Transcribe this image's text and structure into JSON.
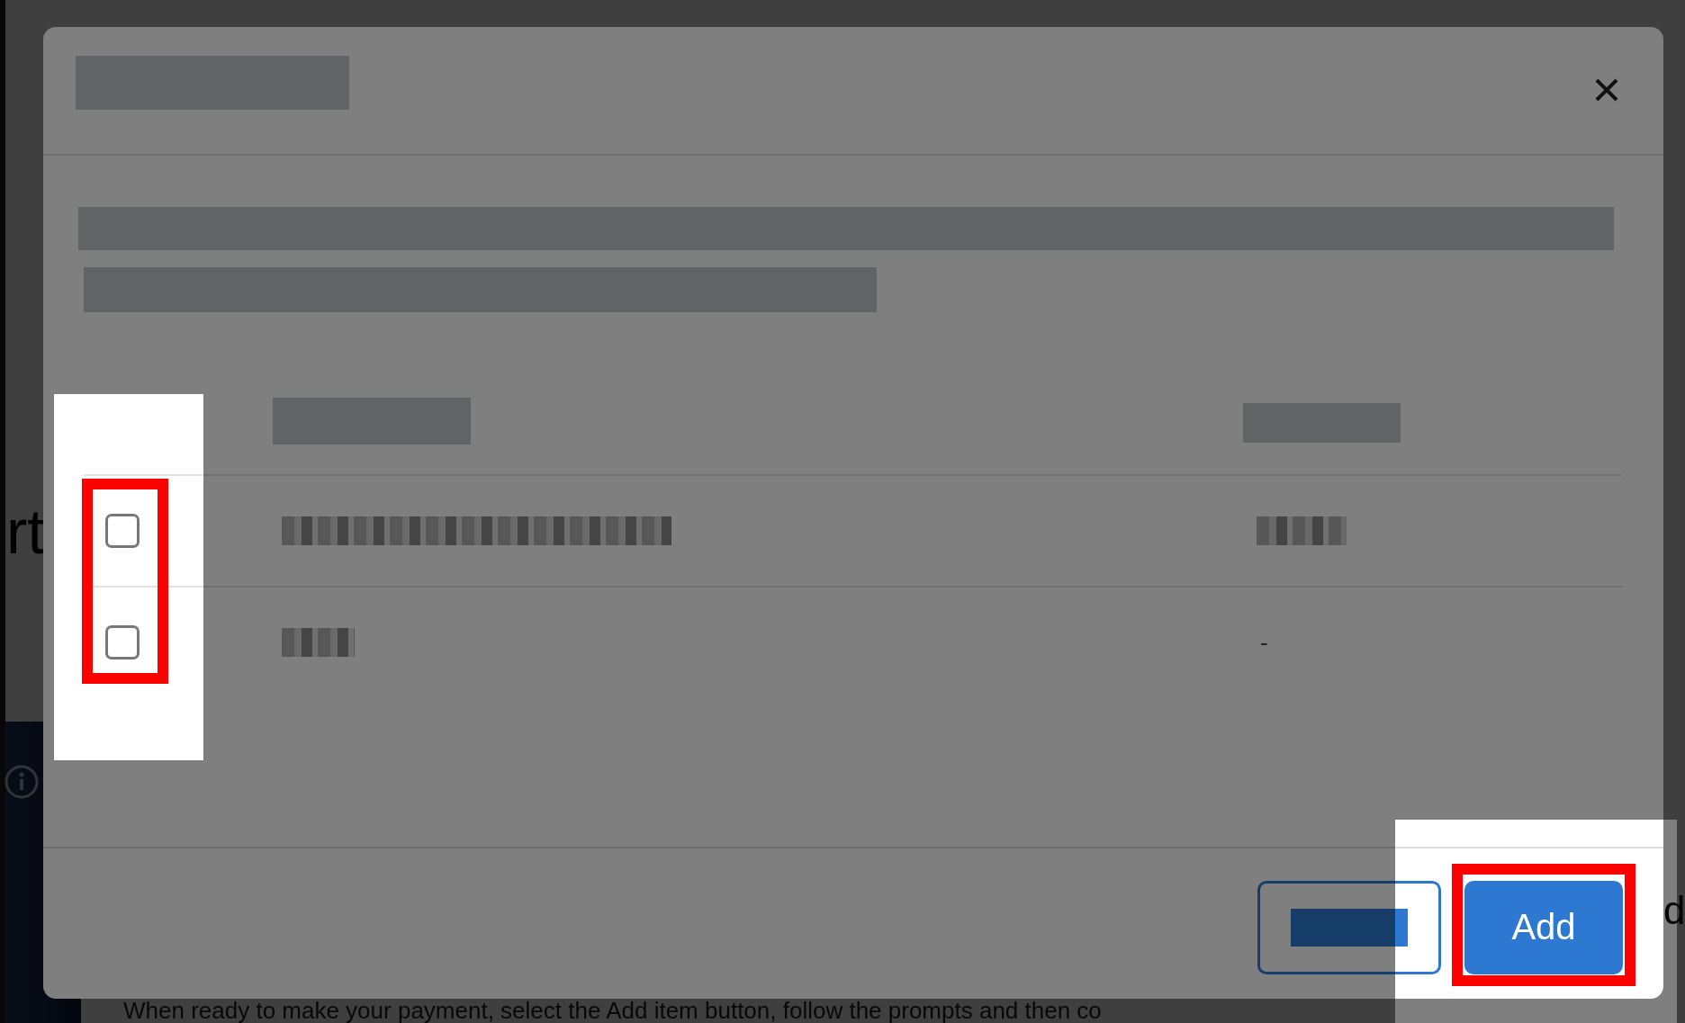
{
  "page": {
    "heading_fragment": "rt",
    "side_fragment": "d",
    "instruction": "When ready to make your payment, select the Add item button, follow the prompts and then co"
  },
  "dialog": {
    "rows": [
      {
        "checked": false
      },
      {
        "checked": false,
        "column_3": "-"
      }
    ],
    "buttons": [
      {
        "kind": "secondary"
      },
      {
        "kind": "primary",
        "label": "Add"
      }
    ]
  }
}
